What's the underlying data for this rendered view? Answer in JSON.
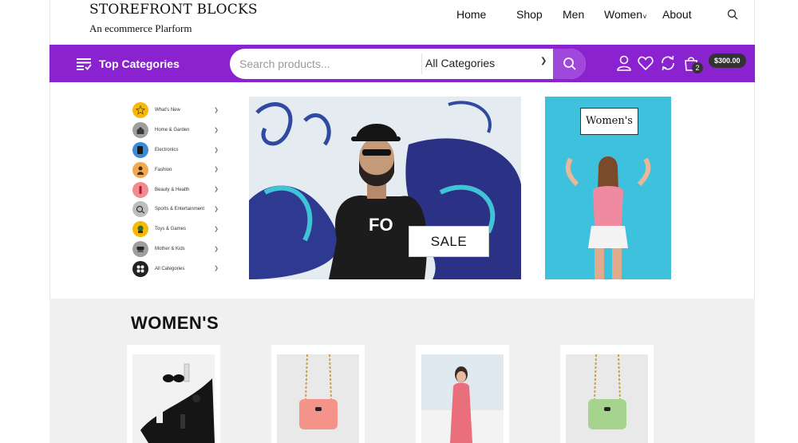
{
  "brand": {
    "title": "STOREFRONT BLOCKS",
    "subtitle": "An ecommerce Plarform"
  },
  "nav": {
    "items": [
      "Home",
      "Shop",
      "Men",
      "Women",
      "About"
    ],
    "women_caret": "v"
  },
  "bar": {
    "categories_label": "Top Categories",
    "search_placeholder": "Search products...",
    "category_select": "All Categories",
    "cart_count": "2",
    "cart_total": "$300.00"
  },
  "categories": [
    {
      "label": "What's New",
      "icon": "star-icon",
      "color": "#f5b90a"
    },
    {
      "label": "Home & Garden",
      "icon": "home-garden-icon",
      "color": "#9e9e9e"
    },
    {
      "label": "Electronics",
      "icon": "electronics-icon",
      "color": "#3b8bd8"
    },
    {
      "label": "Fashion",
      "icon": "fashion-icon",
      "color": "#f0a94e"
    },
    {
      "label": "Beauty & Health",
      "icon": "beauty-icon",
      "color": "#f28b8b"
    },
    {
      "label": "Sports & Entertainment",
      "icon": "sports-icon",
      "color": "#bdbdbd"
    },
    {
      "label": "Toys & Games",
      "icon": "toys-icon",
      "color": "#f5b90a"
    },
    {
      "label": "Mother & Kids",
      "icon": "mother-kids-icon",
      "color": "#9e9e9e"
    },
    {
      "label": "All Categories",
      "icon": "grid-icon",
      "color": "#222222"
    }
  ],
  "hero": {
    "sale_label": "SALE",
    "shirt_text": "FO"
  },
  "side_banner": {
    "label": "Women's"
  },
  "section": {
    "title": "WOMEN'S"
  },
  "colors": {
    "accent": "#8b22cf",
    "search_button": "#a047dc",
    "banner_blue": "#3dc1dc"
  }
}
